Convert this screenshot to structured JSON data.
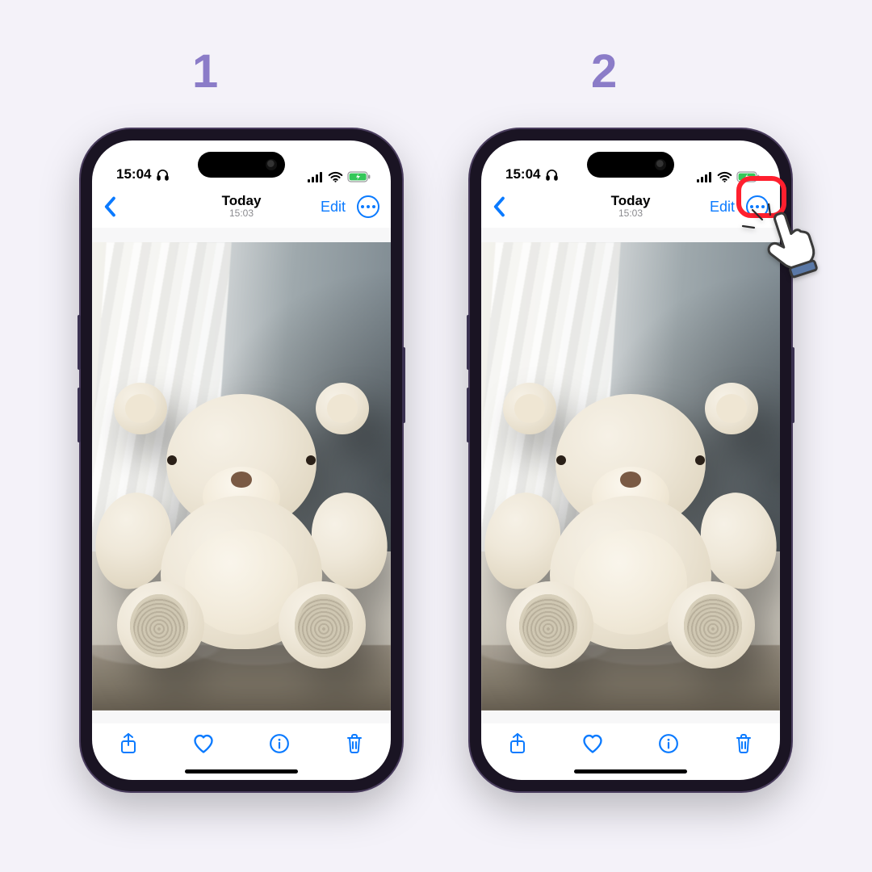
{
  "steps": {
    "one": "1",
    "two": "2"
  },
  "status": {
    "time": "15:04"
  },
  "nav": {
    "title": "Today",
    "subtitle": "15:03",
    "edit": "Edit"
  },
  "icons": {
    "back": "chevron-left-icon",
    "more": "more-circle-icon",
    "share": "share-icon",
    "heart": "heart-icon",
    "info": "info-icon",
    "trash": "trash-icon",
    "headphones": "headphones-icon",
    "signal": "cellular-signal-icon",
    "wifi": "wifi-icon",
    "battery": "battery-charging-icon"
  },
  "photo": {
    "subject": "teddy bear by window"
  },
  "colors": {
    "accent": "#0a7aff",
    "stepLabel": "#8b7cc8",
    "calloutRed": "#ff1f2e",
    "pageBg": "#f4f2f9"
  }
}
